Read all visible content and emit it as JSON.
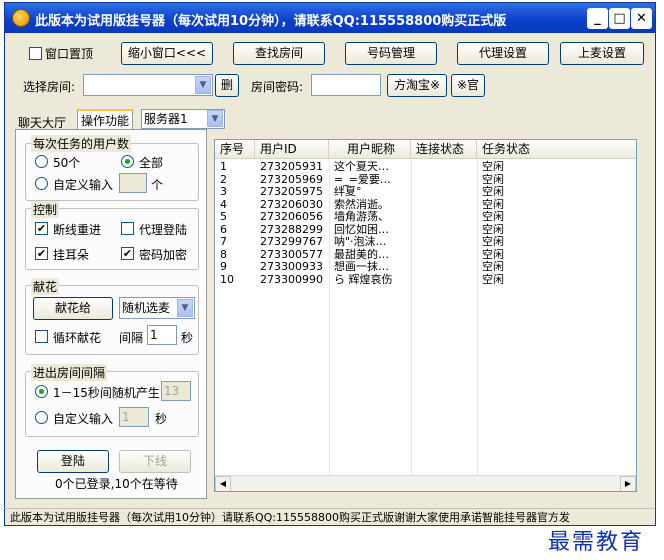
{
  "window": {
    "title": "此版本为试用版挂号器（每次试用10分钟），请联系QQ:115558800购买正式版",
    "min_glyph": "_",
    "max_glyph": "□",
    "close_glyph": "✕"
  },
  "toolbar": {
    "pin_label": "窗口置顶",
    "shrink_label": "缩小窗口<<<",
    "find_room_label": "查找房间",
    "account_mgmt_label": "号码管理",
    "proxy_label": "代理设置",
    "mic_label": "上麦设置"
  },
  "room": {
    "select_label": "选择房间:",
    "select_value": "",
    "delete_label": "删",
    "password_label": "房间密码:",
    "password_value": "",
    "taobao_label": "方淘宝※",
    "official_label": "※官"
  },
  "tabs": [
    "聊天大厅",
    "操作功能"
  ],
  "server": {
    "value": "服务器1"
  },
  "users_per_task": {
    "title": "每次任务的用户数",
    "opt_50": "50个",
    "opt_all": "全部",
    "opt_custom": "自定义输入",
    "custom_value": "",
    "unit": "个"
  },
  "control": {
    "title": "控制",
    "reconnect": "断线重进",
    "proxy_login": "代理登陆",
    "ears": "挂耳朵",
    "encrypt": "密码加密"
  },
  "flowers": {
    "title": "献花",
    "give_label": "献花给",
    "select_value": "随机选麦",
    "loop_label": "循环献花",
    "interval_label": "间隔",
    "interval_value": "1",
    "unit": "秒"
  },
  "room_interval": {
    "title": "进出房间间隔",
    "opt_random": "1－15秒间随机产生",
    "random_value": "13",
    "opt_custom": "自定义输入",
    "custom_value": "1",
    "unit": "秒"
  },
  "login": {
    "login_label": "登陆",
    "logout_label": "下线",
    "status": "0个已登录,10个在等待"
  },
  "table": {
    "columns": [
      "序号",
      "用户ID",
      "用户昵称",
      "连接状态",
      "任务状态"
    ],
    "rows": [
      [
        "1",
        "273205931",
        "这个夏天…",
        "",
        "空闲"
      ],
      [
        "2",
        "273205969",
        "=_=爱要…",
        "",
        "空闲"
      ],
      [
        "3",
        "273205975",
        "绊夏°",
        "",
        "空闲"
      ],
      [
        "4",
        "273206030",
        "索然消逝。",
        "",
        "空闲"
      ],
      [
        "5",
        "273206056",
        "墙角游荡、",
        "",
        "空闲"
      ],
      [
        "6",
        "273288299",
        "回忆如困…",
        "",
        "空闲"
      ],
      [
        "7",
        "273299767",
        "呐\"·泡沫…",
        "",
        "空闲"
      ],
      [
        "8",
        "273300577",
        "最甜美的…",
        "",
        "空闲"
      ],
      [
        "9",
        "273300933",
        "想画一抹…",
        "",
        "空闲"
      ],
      [
        "10",
        "273300990",
        "ら 辉煌哀伤",
        "",
        "空闲"
      ]
    ]
  },
  "statusbar": {
    "text": "此版本为试用版挂号器（每次试用10分钟）请联系QQ:115558800购买正式版谢谢大家使用承诺智能挂号器官方发"
  },
  "watermark": "最需教育",
  "colors": {
    "title_bar": "#0a3fc8",
    "window_bg": "#ece9d8",
    "radio_dot": "#21a121"
  }
}
